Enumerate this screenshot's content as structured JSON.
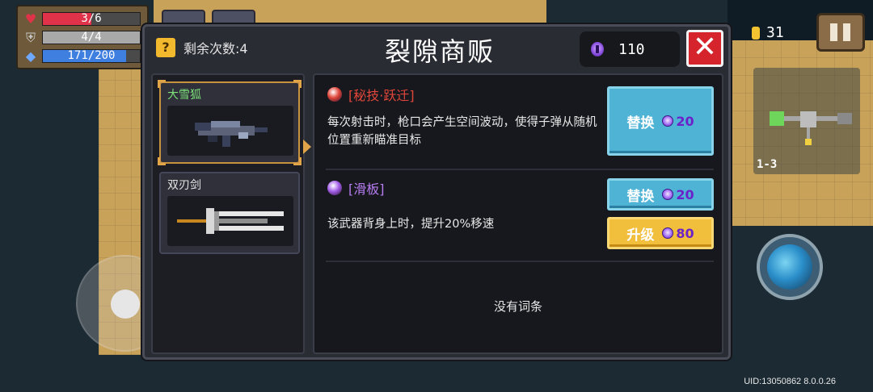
{
  "hud": {
    "hp": "3/6",
    "armor": "4/4",
    "energy": "171/200",
    "hp_fill": 0.5,
    "armor_fill": 1.0,
    "energy_fill": 0.855,
    "coins": "31",
    "floor": "1-3",
    "uid": "UID:13050862 8.0.0.26"
  },
  "shop": {
    "title": "裂隙商贩",
    "remaining_label": "剩余次数:4",
    "question_mark": "?",
    "gems": "110",
    "close_symbol": "✕",
    "weapons": [
      {
        "name": "大雪狐",
        "selected": true
      },
      {
        "name": "双刃剑",
        "selected": false
      }
    ],
    "perks": [
      {
        "name": "[秘技·跃迁]",
        "name_color": "#e0463a",
        "gem_color": "#e0463a",
        "description": "每次射击时，枪口会产生空间波动，使得子弹从随机位置重新瞄准目标",
        "buttons": [
          {
            "label": "替换",
            "cost": "20",
            "style": "blue"
          }
        ]
      },
      {
        "name": "[滑板]",
        "name_color": "#b57cf0",
        "gem_color": "#a35ee8",
        "description": "该武器背身上时，提升20%移速",
        "buttons": [
          {
            "label": "替换",
            "cost": "20",
            "style": "blue"
          },
          {
            "label": "升级",
            "cost": "80",
            "style": "gold"
          }
        ]
      }
    ],
    "empty_slot_text": "没有词条"
  },
  "colors": {
    "hp_bar": "#e0334a",
    "armor_bar": "#a9a9a9",
    "energy_bar": "#3f7fe0",
    "weapon_name_selected": "#7de07a",
    "weapon_name": "#e4e4e4"
  }
}
